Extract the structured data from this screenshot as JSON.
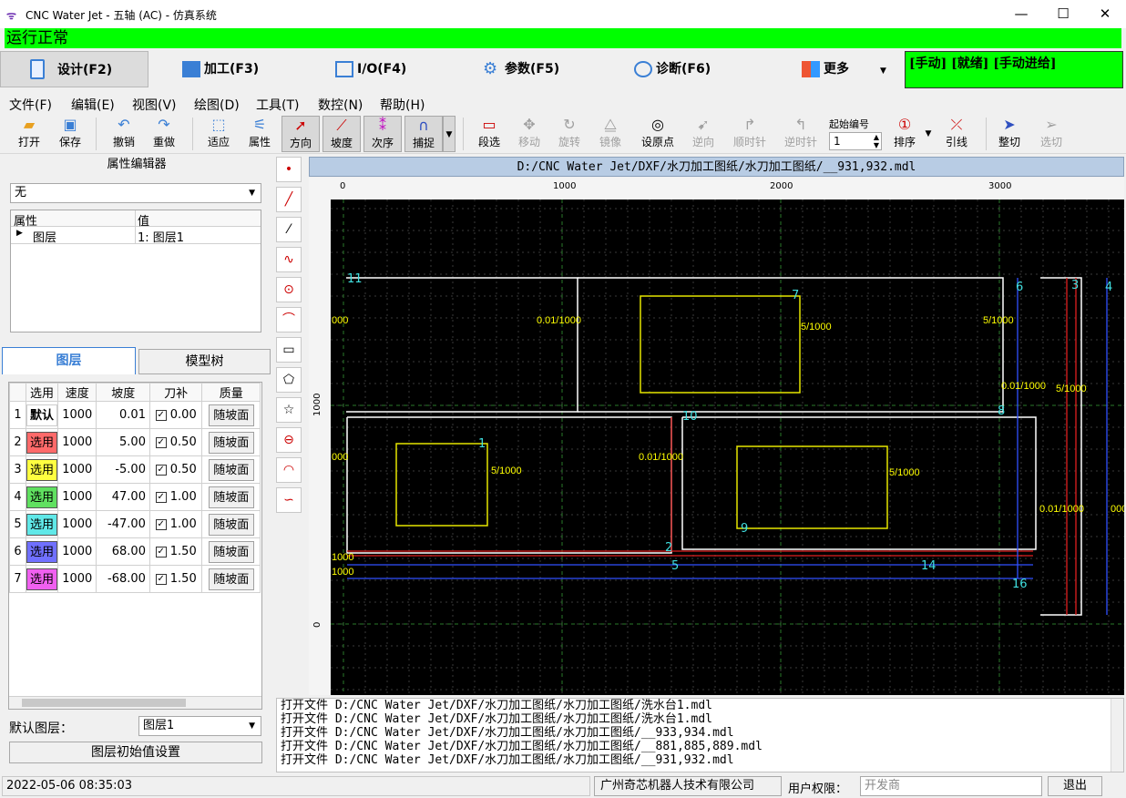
{
  "window": {
    "title": "CNC Water Jet - 五轴 (AC)  - 仿真系统",
    "min": "—",
    "max": "☐",
    "close": "✕"
  },
  "status_line": "运行正常",
  "nav": {
    "design": "设计(F2)",
    "machining": "加工(F3)",
    "io": "I/O(F4)",
    "params": "参数(F5)",
    "diag": "诊断(F6)",
    "more": "更多",
    "state": "[手动] [就绪] [手动进给]"
  },
  "menu": [
    "文件(F)",
    "编辑(E)",
    "视图(V)",
    "绘图(D)",
    "工具(T)",
    "数控(N)",
    "帮助(H)"
  ],
  "toolbar": {
    "open": "打开",
    "save": "保存",
    "undo": "撤销",
    "redo": "重做",
    "fit": "适应",
    "props": "属性",
    "direction": "方向",
    "slope": "坡度",
    "order": "次序",
    "snap": "捕捉",
    "segsel": "段选",
    "move": "移动",
    "rotate": "旋转",
    "mirror": "镜像",
    "setpoint": "设原点",
    "reverse": "逆向",
    "cw": "顺时针",
    "ccw": "逆时针",
    "start_label": "起始编号",
    "start_value": "1",
    "sort": "排序",
    "leadline": "引线",
    "trim": "整切",
    "selcut": "选切"
  },
  "panel": {
    "title": "属性编辑器",
    "combo": "无",
    "prop_header": "属性",
    "value_header": "值",
    "prop_row_key": "图层",
    "prop_row_val": "1: 图层1",
    "tab_layers": "图层",
    "tab_model": "模型树",
    "headers": [
      "选用",
      "速度",
      "坡度",
      "刀补",
      "质量"
    ],
    "rows": [
      {
        "n": "1",
        "sel": "默认",
        "speed": "1000",
        "slope": "0.01",
        "comp": "0.00",
        "q": "随坡面",
        "color": "#ffffff"
      },
      {
        "n": "2",
        "sel": "选用",
        "speed": "1000",
        "slope": "5.00",
        "comp": "0.50",
        "q": "随坡面",
        "color": "#ff6a6a"
      },
      {
        "n": "3",
        "sel": "选用",
        "speed": "1000",
        "slope": "-5.00",
        "comp": "0.50",
        "q": "随坡面",
        "color": "#ffff40"
      },
      {
        "n": "4",
        "sel": "选用",
        "speed": "1000",
        "slope": "47.00",
        "comp": "1.00",
        "q": "随坡面",
        "color": "#60e060"
      },
      {
        "n": "5",
        "sel": "选用",
        "speed": "1000",
        "slope": "-47.00",
        "comp": "1.00",
        "q": "随坡面",
        "color": "#60e8e8"
      },
      {
        "n": "6",
        "sel": "选用",
        "speed": "1000",
        "slope": "68.00",
        "comp": "1.50",
        "q": "随坡面",
        "color": "#7070ff"
      },
      {
        "n": "7",
        "sel": "选用",
        "speed": "1000",
        "slope": "-68.00",
        "comp": "1.50",
        "q": "随坡面",
        "color": "#f060f0"
      }
    ],
    "default_layer_label": "默认图层：",
    "default_layer_value": "图层1",
    "init_button": "图层初始值设置"
  },
  "canvas": {
    "path": "D:/CNC Water Jet/DXF/水刀加工图纸/水刀加工图纸/__931,932.mdl",
    "ruler_x": [
      "0",
      "1000",
      "2000",
      "3000"
    ],
    "ruler_y": [
      "1000",
      "0"
    ]
  },
  "log": [
    "打开文件 D:/CNC Water Jet/DXF/水刀加工图纸/水刀加工图纸/洗水台1.mdl",
    "打开文件 D:/CNC Water Jet/DXF/水刀加工图纸/水刀加工图纸/洗水台1.mdl",
    "打开文件 D:/CNC Water Jet/DXF/水刀加工图纸/水刀加工图纸/__933,934.mdl",
    "打开文件 D:/CNC Water Jet/DXF/水刀加工图纸/水刀加工图纸/__881,885,889.mdl",
    "打开文件 D:/CNC Water Jet/DXF/水刀加工图纸/水刀加工图纸/__931,932.mdl"
  ],
  "footer": {
    "datetime": "2022-05-06 08:35:03",
    "company": "广州奇芯机器人技术有限公司",
    "perm_label": "用户权限：",
    "perm_value": "开发商",
    "exit": "退出"
  }
}
